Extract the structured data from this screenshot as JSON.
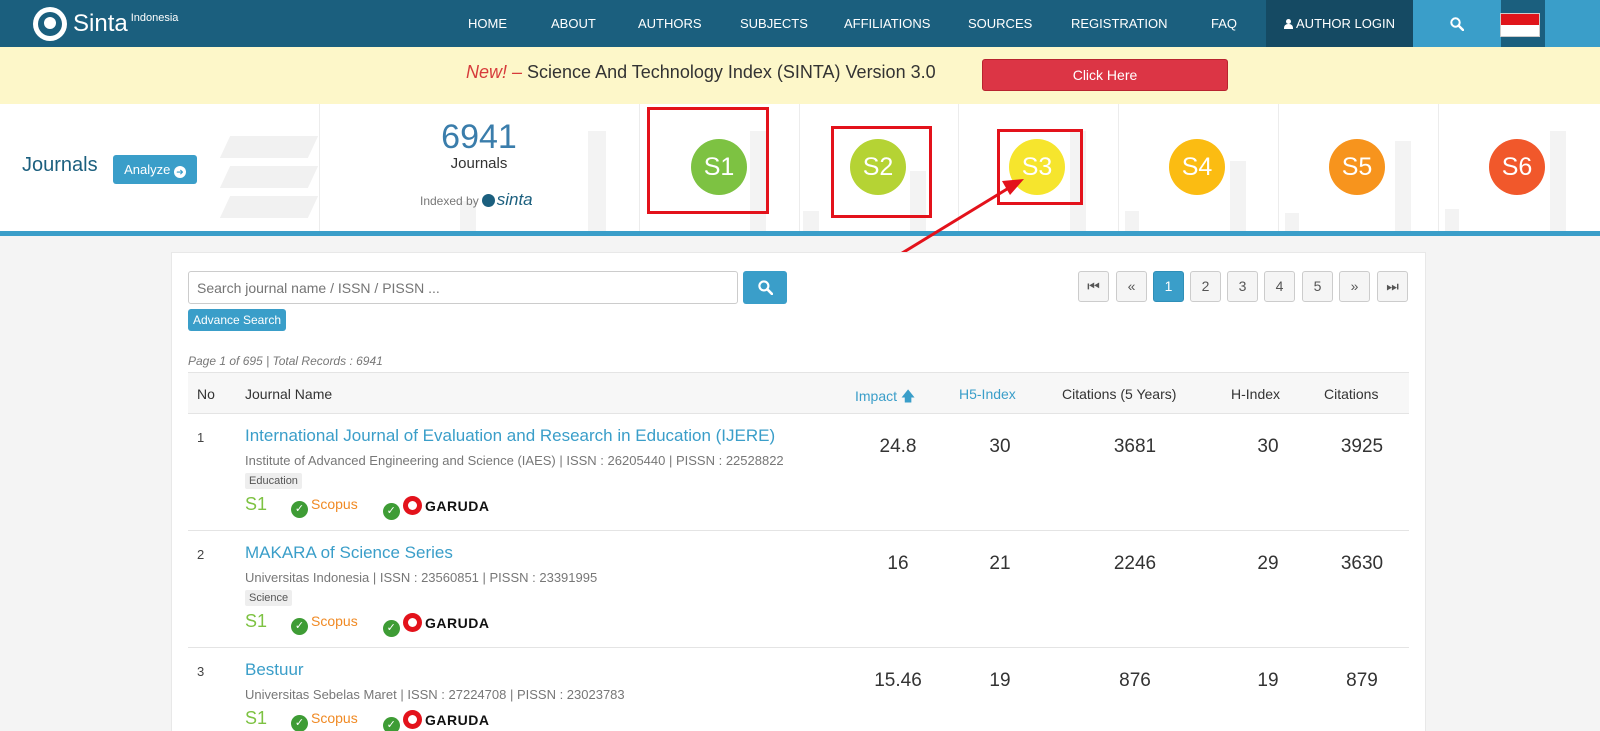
{
  "nav": {
    "brand": "Sinta",
    "brand_sub": "Indonesia",
    "items": [
      {
        "label": "HOME"
      },
      {
        "label": "ABOUT"
      },
      {
        "label": "AUTHORS"
      },
      {
        "label": "SUBJECTS"
      },
      {
        "label": "AFFILIATIONS"
      },
      {
        "label": "SOURCES"
      },
      {
        "label": "REGISTRATION"
      },
      {
        "label": "FAQ"
      }
    ],
    "login_label": "AUTHOR LOGIN",
    "search_icon": "search-icon",
    "flag": "indonesia-flag"
  },
  "announcement": {
    "new_label": "New! –",
    "text": " Science And Technology Index (SINTA) Version 3.0",
    "button_label": "Click Here"
  },
  "stats": {
    "section_label": "Journals",
    "analyze_label": "Analyze",
    "total": "6941",
    "total_label": "Journals",
    "indexed_label": "Indexed by",
    "indexed_brand": "sinta",
    "ranks": [
      {
        "label": "S1",
        "color": "#7dc242"
      },
      {
        "label": "S2",
        "color": "#b5d334"
      },
      {
        "label": "S3",
        "color": "#f6e52d"
      },
      {
        "label": "S4",
        "color": "#fbbc12"
      },
      {
        "label": "S5",
        "color": "#f7941d"
      },
      {
        "label": "S6",
        "color": "#f1582b"
      }
    ]
  },
  "search": {
    "placeholder": "Search journal name / ISSN / PISSN ...",
    "advanced_label": "Advance Search"
  },
  "pagination": {
    "first": "⏮",
    "prev": "«",
    "pages": [
      "1",
      "2",
      "3",
      "4",
      "5"
    ],
    "active_page": "1",
    "next": "»",
    "last": "⏭"
  },
  "page_info": "Page 1 of 695 | Total Records : 6941",
  "table": {
    "headers": {
      "no": "No",
      "name": "Journal Name",
      "impact": "Impact",
      "h5": "H5-Index",
      "cit5": "Citations (5 Years)",
      "hindex": "H-Index",
      "citations": "Citations"
    },
    "rows": [
      {
        "no": "1",
        "name": "International Journal of Evaluation and Research in Education (IJERE)",
        "affiliation": "Institute of Advanced Engineering and Science (IAES) | ISSN : 26205440 | PISSN : 22528822",
        "subject": "Education",
        "rank": "S1",
        "scopus": "Scopus",
        "garuda": "GARUDA",
        "impact": "24.8",
        "h5": "30",
        "cit5": "3681",
        "hindex": "30",
        "citations": "3925"
      },
      {
        "no": "2",
        "name": "MAKARA of Science Series",
        "affiliation": "Universitas Indonesia | ISSN : 23560851 | PISSN : 23391995",
        "subject": "Science",
        "rank": "S1",
        "scopus": "Scopus",
        "garuda": "GARUDA",
        "impact": "16",
        "h5": "21",
        "cit5": "2246",
        "hindex": "29",
        "citations": "3630"
      },
      {
        "no": "3",
        "name": "Bestuur",
        "affiliation": "Universitas Sebelas Maret | ISSN : 27224708 | PISSN : 23023783",
        "rank": "S1",
        "scopus": "Scopus",
        "garuda": "GARUDA",
        "impact": "15.46",
        "h5": "19",
        "cit5": "876",
        "hindex": "19",
        "citations": "879"
      }
    ]
  },
  "colors": {
    "nav_bg": "#1b5f7e",
    "accent": "#3a9ec9",
    "annotation": "#e3121b"
  }
}
